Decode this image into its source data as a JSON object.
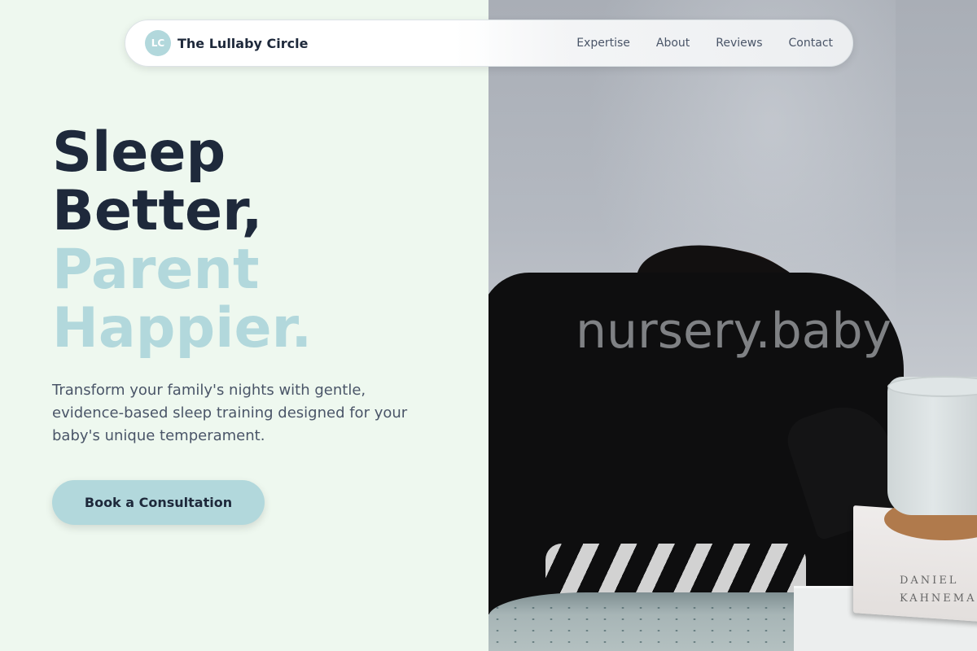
{
  "nav": {
    "logo_initials": "LC",
    "brand": "The Lullaby Circle",
    "links": [
      "Expertise",
      "About",
      "Reviews",
      "Contact"
    ]
  },
  "hero": {
    "headline_line1": "Sleep",
    "headline_line2": "Better,",
    "headline_line3": "Parent",
    "headline_line4": "Happier.",
    "subtitle": "Transform your family's nights with gentle, evidence-based sleep training designed for your baby's unique temperament.",
    "cta_label": "Book a Consultation"
  },
  "photo": {
    "watermark": "nursery.baby",
    "book_author_line1": "DANIEL",
    "book_author_line2": "KAHNEMAN"
  },
  "colors": {
    "background": "#eef8ef",
    "accent": "#b2d8dc",
    "heading": "#1e293b",
    "body_text": "#4a5568"
  }
}
